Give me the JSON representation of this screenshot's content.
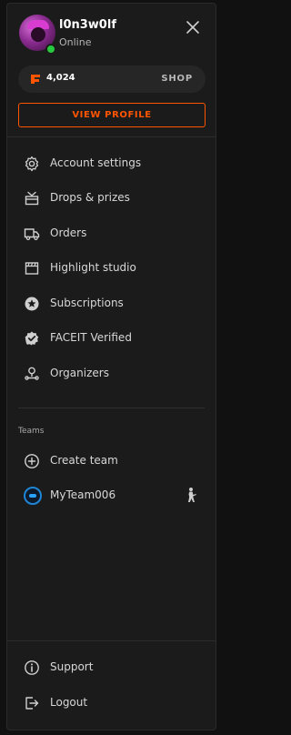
{
  "user": {
    "username": "l0n3w0lf",
    "status": "Online",
    "avatar_icon": "avatar-icon",
    "status_color": "#27c93f"
  },
  "wallet": {
    "points": "4,024",
    "shop_label": "SHOP",
    "icon": "faceit-points-icon"
  },
  "actions": {
    "view_profile_label": "VIEW PROFILE"
  },
  "menu": {
    "items": [
      {
        "label": "Account settings",
        "icon": "gear-icon"
      },
      {
        "label": "Drops & prizes",
        "icon": "gift-box-icon"
      },
      {
        "label": "Orders",
        "icon": "truck-icon"
      },
      {
        "label": "Highlight studio",
        "icon": "clapperboard-icon"
      },
      {
        "label": "Subscriptions",
        "icon": "star-badge-icon"
      },
      {
        "label": "FACEIT Verified",
        "icon": "verified-badge-icon"
      },
      {
        "label": "Organizers",
        "icon": "organizer-icon"
      }
    ]
  },
  "teams": {
    "title": "Teams",
    "create_label": "Create team",
    "items": [
      {
        "name": "MyTeam006",
        "game_icon": "soldier-icon"
      }
    ]
  },
  "footer": {
    "support_label": "Support",
    "logout_label": "Logout"
  },
  "colors": {
    "accent": "#ff5500",
    "panel": "#1b1b1b",
    "background": "#111111"
  }
}
